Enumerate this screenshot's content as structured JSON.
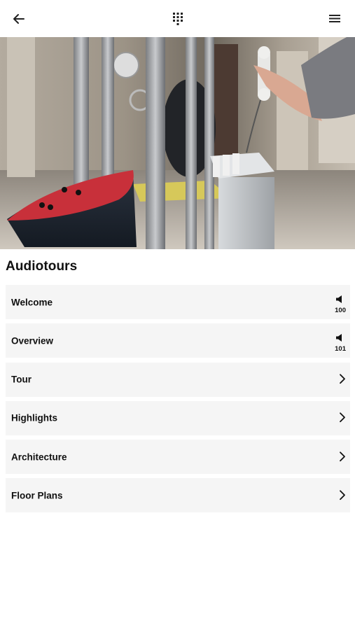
{
  "header": {
    "back_icon": "arrow-left-icon",
    "keypad_icon": "keypad-icon",
    "menu_icon": "hamburger-menu-icon"
  },
  "hero": {
    "image": "museum-installation-photo"
  },
  "section": {
    "title": "Audiotours"
  },
  "items": [
    {
      "label": "Welcome",
      "type": "audio",
      "icon": "speaker-icon",
      "number": "100"
    },
    {
      "label": "Overview",
      "type": "audio",
      "icon": "speaker-icon",
      "number": "101"
    },
    {
      "label": "Tour",
      "type": "link",
      "icon": "chevron-right-icon"
    },
    {
      "label": "Highlights",
      "type": "link",
      "icon": "chevron-right-icon"
    },
    {
      "label": "Architecture",
      "type": "link",
      "icon": "chevron-right-icon"
    },
    {
      "label": "Floor Plans",
      "type": "link",
      "icon": "chevron-right-icon"
    }
  ],
  "colors": {
    "background": "#ffffff",
    "row_background": "#f5f5f5",
    "text": "#111111"
  }
}
